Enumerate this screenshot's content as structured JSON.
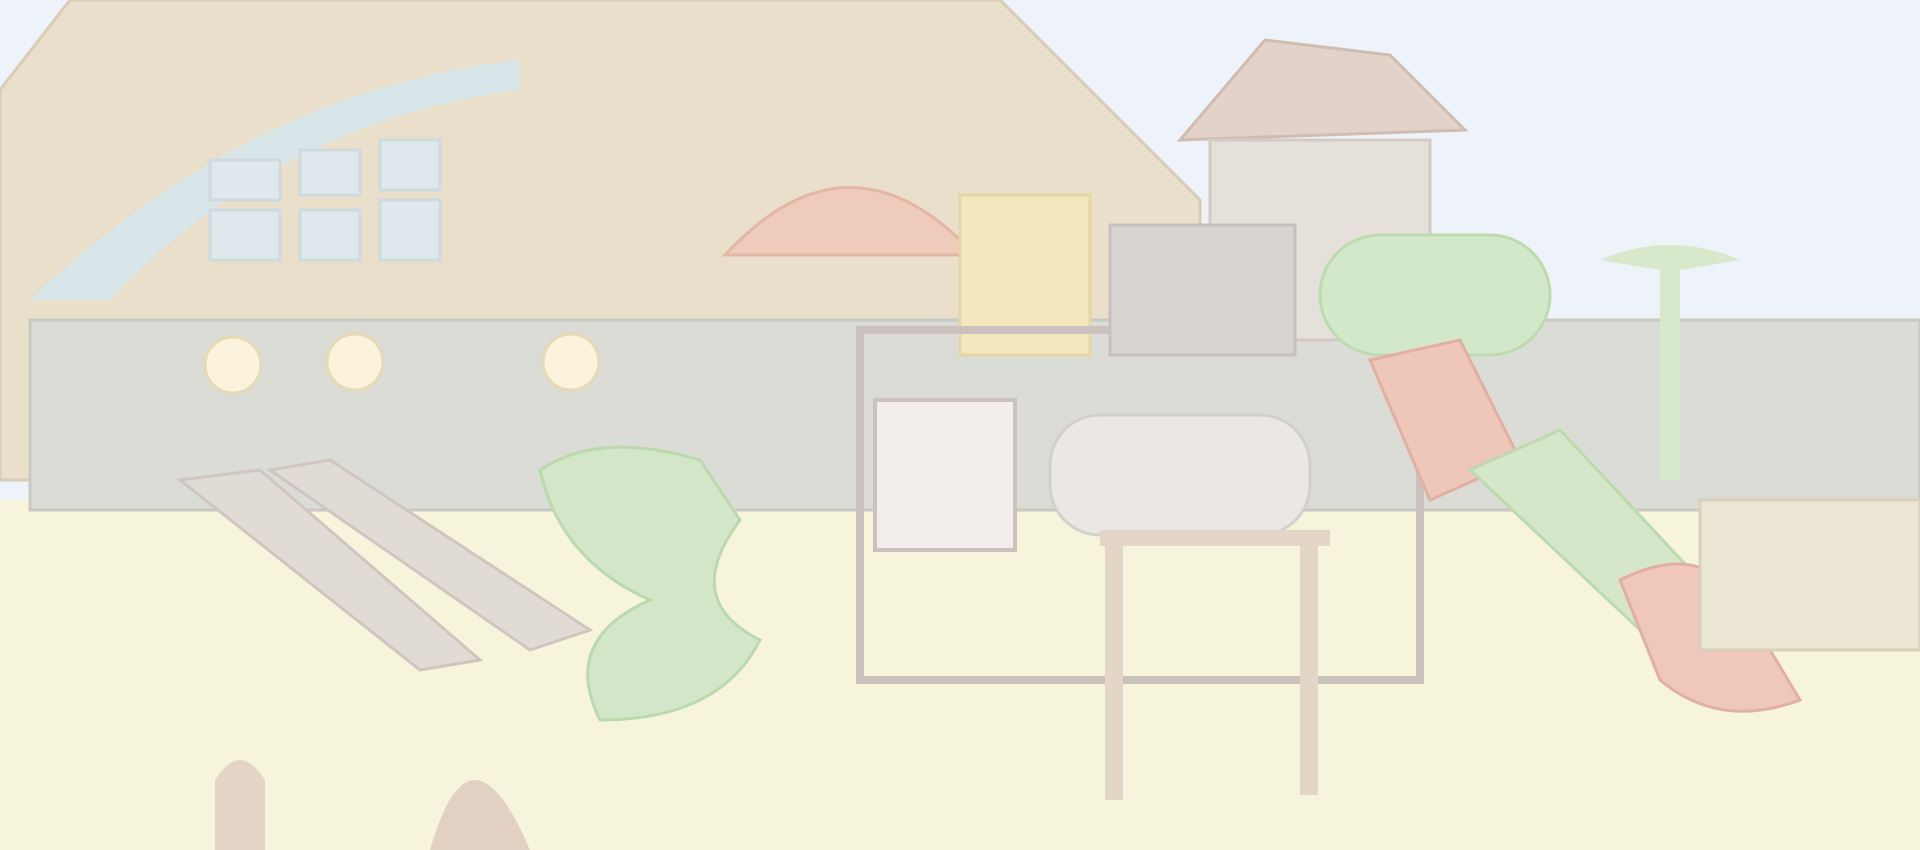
{
  "colors": {
    "sky": "#f1f4fa",
    "ground": "#f8f8e6",
    "building": "#efe9dc",
    "fence": "#e3e3de",
    "green": "#dcebd0",
    "red": "#efd3cc",
    "yellow": "#f6efd4",
    "frame": "#dcd6d2"
  }
}
